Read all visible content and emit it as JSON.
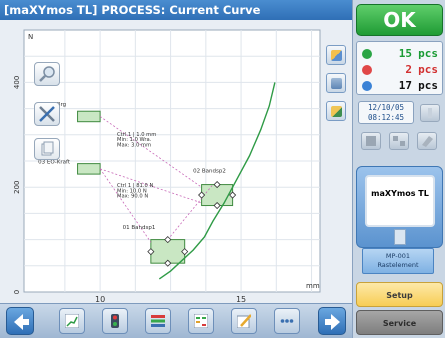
{
  "window": {
    "title": "[maXYmos TL] PROCESS: Current Curve"
  },
  "chart_data": {
    "type": "line",
    "title": "",
    "xlabel": "mm",
    "ylabel": "N",
    "xlim": [
      7.3,
      17.8
    ],
    "ylim": [
      0,
      500
    ],
    "x_ticks": [
      "10",
      "15"
    ],
    "y_ticks": [
      "0",
      "200",
      "400"
    ],
    "grid": true,
    "series": [
      {
        "x": [
          12.1,
          12.5,
          12.9,
          13.3,
          13.7,
          14.0,
          14.4,
          14.8,
          15.3,
          15.7,
          16.0,
          16.2
        ],
        "y": [
          25,
          40,
          60,
          80,
          105,
          135,
          170,
          210,
          260,
          310,
          355,
          400
        ]
      }
    ],
    "annotations": [
      {
        "id": "04",
        "label": "04 Off-Brg"
      },
      {
        "id": "03",
        "label": "03 EO-Kraft"
      },
      {
        "id": "02",
        "label": "02 Bandsp2"
      },
      {
        "id": "01",
        "label": "01 Bandsp1"
      }
    ],
    "evaluation_text": [
      "Ctrl 1 | 1.0 mm",
      "Min: 1.0 Wra.",
      "Max: 3.0 mm",
      "Ctrl 1 | 81.0 N",
      "Min: 10.0 N",
      "Max: 90.0 N"
    ]
  },
  "counts": {
    "ok": {
      "value": "15",
      "unit": "pcs",
      "color": "#1a9b34"
    },
    "nok": {
      "value": "2",
      "unit": "pcs",
      "color": "#d23030"
    },
    "total": {
      "value": "17",
      "unit": "pcs",
      "color": "#111111"
    }
  },
  "status": {
    "date": "12/10/05",
    "time": "08:12:45"
  },
  "buttons": {
    "ok": "OK",
    "setup": "Setup",
    "service": "Service"
  },
  "device": {
    "name": "maXYmos TL"
  },
  "program": {
    "line1": "MP-001",
    "line2": "Rastelement"
  },
  "icons": {
    "zoom": "magnifier-icon",
    "tools": "tools-icon",
    "copy": "copy-icon"
  }
}
